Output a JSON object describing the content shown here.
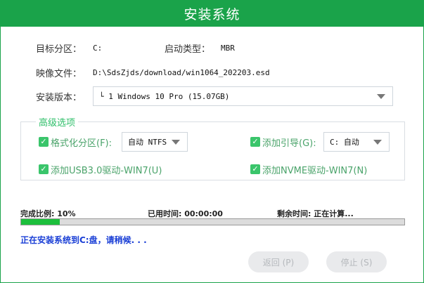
{
  "window": {
    "title": "安装系统"
  },
  "fields": {
    "target_partition": {
      "label": "目标分区：",
      "value": "C:"
    },
    "boot_type": {
      "label": "启动类型：",
      "value": "MBR"
    },
    "image_file": {
      "label": "映像文件：",
      "value": "D:\\SdsZjds/download/win1064_202203.esd"
    },
    "install_version": {
      "label": "安装版本：",
      "value": "└ 1 Windows 10 Pro (15.07GB)"
    }
  },
  "advanced": {
    "title": "高级选项",
    "format_partition": {
      "label": "格式化分区(F):",
      "checked": true,
      "select_value": "自动 NTFS"
    },
    "add_boot": {
      "label": "添加引导(G):",
      "checked": true,
      "select_value": "C: 自动"
    },
    "usb3_driver": {
      "label": "添加USB3.0驱动-WIN7(U)",
      "checked": true
    },
    "nvme_driver": {
      "label": "添加NVME驱动-WIN7(N)",
      "checked": true
    }
  },
  "progress": {
    "complete_label": "完成比例: 10%",
    "percent": 10,
    "elapsed_label": "已用时间: 00:00:00",
    "remaining_label": "剩余时间: 正在计算..."
  },
  "status_message": "正在安装系统到C:盘，请稍候. . .",
  "buttons": {
    "back": "返回 (P)",
    "stop": "停止 (S)"
  },
  "colors": {
    "accent": "#1aa34a",
    "progress_fill": "#1cbf3c",
    "status_text": "#1a3fd6"
  }
}
